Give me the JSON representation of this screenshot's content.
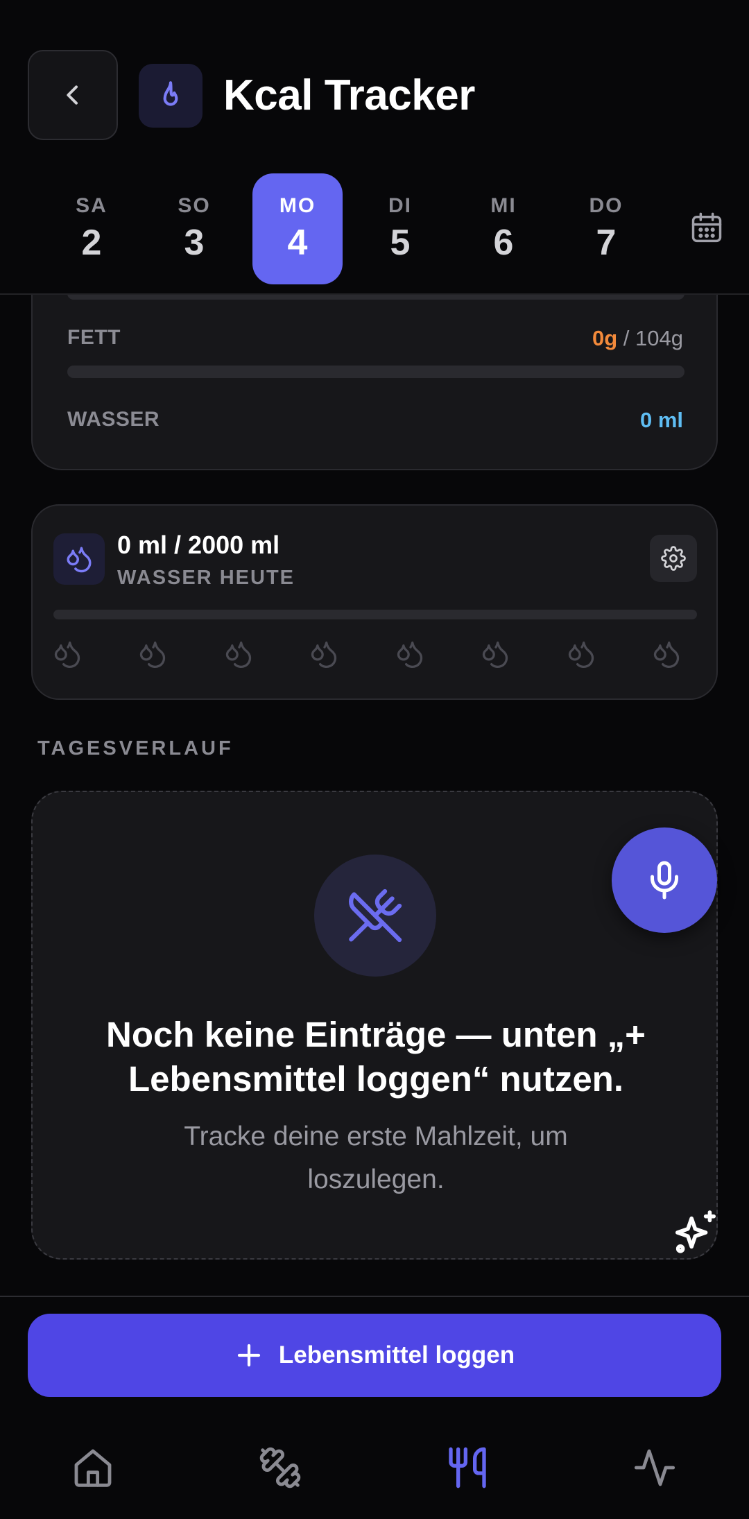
{
  "header": {
    "title": "Kcal Tracker"
  },
  "days": [
    {
      "name": "SA",
      "num": "2"
    },
    {
      "name": "SO",
      "num": "3"
    },
    {
      "name": "MO",
      "num": "4"
    },
    {
      "name": "DI",
      "num": "5"
    },
    {
      "name": "MI",
      "num": "6"
    },
    {
      "name": "DO",
      "num": "7"
    }
  ],
  "selected_day": "MO",
  "macros": {
    "fat": {
      "label": "FETT",
      "current": "0g",
      "goal": "/ 104g"
    },
    "water": {
      "label": "WASSER",
      "current": "0 ml"
    }
  },
  "water_card": {
    "amount": "0 ml / 2000 ml",
    "subtitle": "WASSER HEUTE",
    "progress": 0,
    "glasses_total": 8,
    "glasses_filled": 0
  },
  "timeline": {
    "section_label": "TAGESVERLAUF",
    "empty_title": "Noch keine Einträge — unten „+ Lebensmittel loggen“ nutzen.",
    "empty_subtitle": "Tracke deine erste Mahlzeit, um loszulegen."
  },
  "actions": {
    "log_food_label": "Lebensmittel loggen"
  },
  "nav": {
    "items": [
      "home-icon",
      "dumbbell-icon",
      "utensils-icon",
      "activity-icon"
    ],
    "active": "utensils-icon"
  },
  "colors": {
    "accent": "#6466f1",
    "button": "#4f46e5",
    "fat": "#f38a3b",
    "water": "#5fbdf3",
    "background": "#070709",
    "card": "#17171a"
  }
}
